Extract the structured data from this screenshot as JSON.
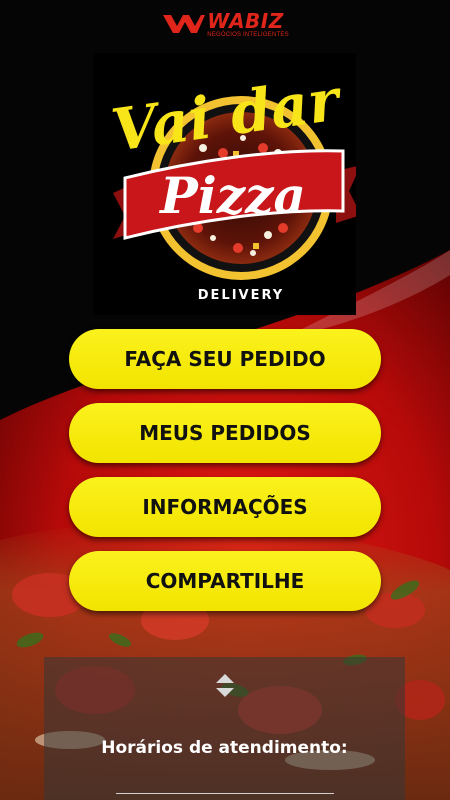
{
  "header": {
    "brand_name": "WABIZ",
    "brand_tagline": "NEGÓCIOS INTELIGENTES"
  },
  "logo": {
    "line1": "Vai dar",
    "line2": "Pizza",
    "line3": "DELIVERY"
  },
  "menu": {
    "order_label": "FAÇA SEU PEDIDO",
    "my_orders_label": "MEUS PEDIDOS",
    "info_label": "INFORMAÇÕES",
    "share_label": "COMPARTILHE"
  },
  "hours": {
    "title": "Horários de atendimento:"
  },
  "colors": {
    "accent_yellow": "#f5e800",
    "brand_red": "#e0251b",
    "background_red": "#c8100e"
  }
}
